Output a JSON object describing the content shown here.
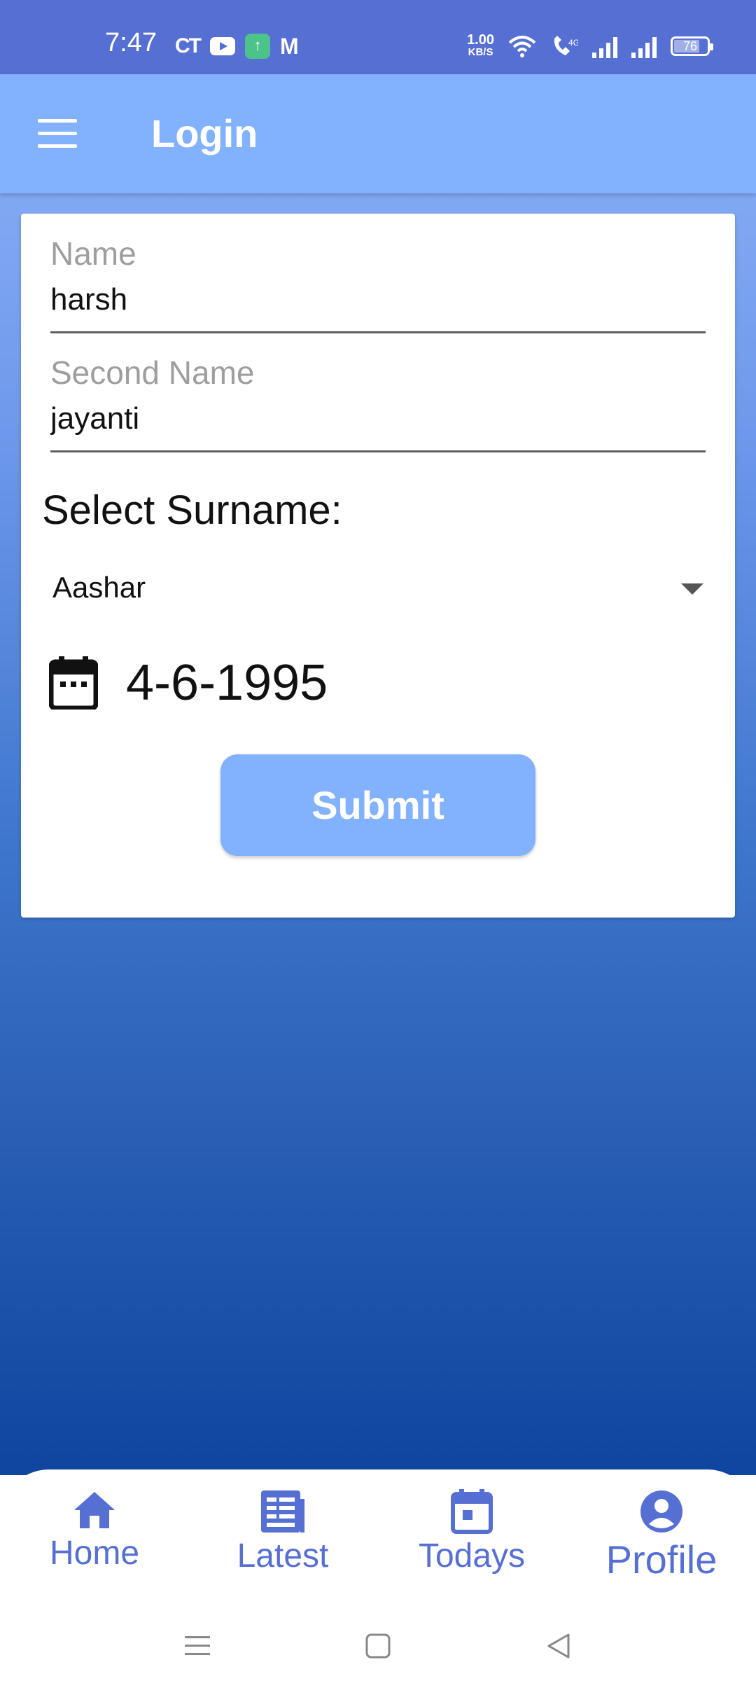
{
  "status_bar": {
    "time": "7:47",
    "left_icons": [
      "ct-icon",
      "youtube-icon",
      "upload-app-icon",
      "gmail-icon"
    ],
    "speed_value": "1.00",
    "speed_unit": "KB/S",
    "battery": "76"
  },
  "app_bar": {
    "title": "Login",
    "menu_icon": "hamburger-menu-icon"
  },
  "form": {
    "name_label": "Name",
    "name_value": "harsh",
    "second_name_label": "Second Name",
    "second_name_value": "jayanti",
    "surname_heading": "Select Surname:",
    "surname_selected": "Aashar",
    "date_value": "4-6-1995",
    "submit_label": "Submit"
  },
  "bottom_nav": {
    "items": [
      {
        "label": "Home",
        "icon": "home-icon"
      },
      {
        "label": "Latest",
        "icon": "newspaper-icon"
      },
      {
        "label": "Todays",
        "icon": "calendar-today-icon"
      },
      {
        "label": "Profile",
        "icon": "account-circle-icon"
      }
    ]
  },
  "colors": {
    "accent": "#566fd3",
    "app_bar": "#82b1fd",
    "gradient_bottom": "#0f459f"
  }
}
